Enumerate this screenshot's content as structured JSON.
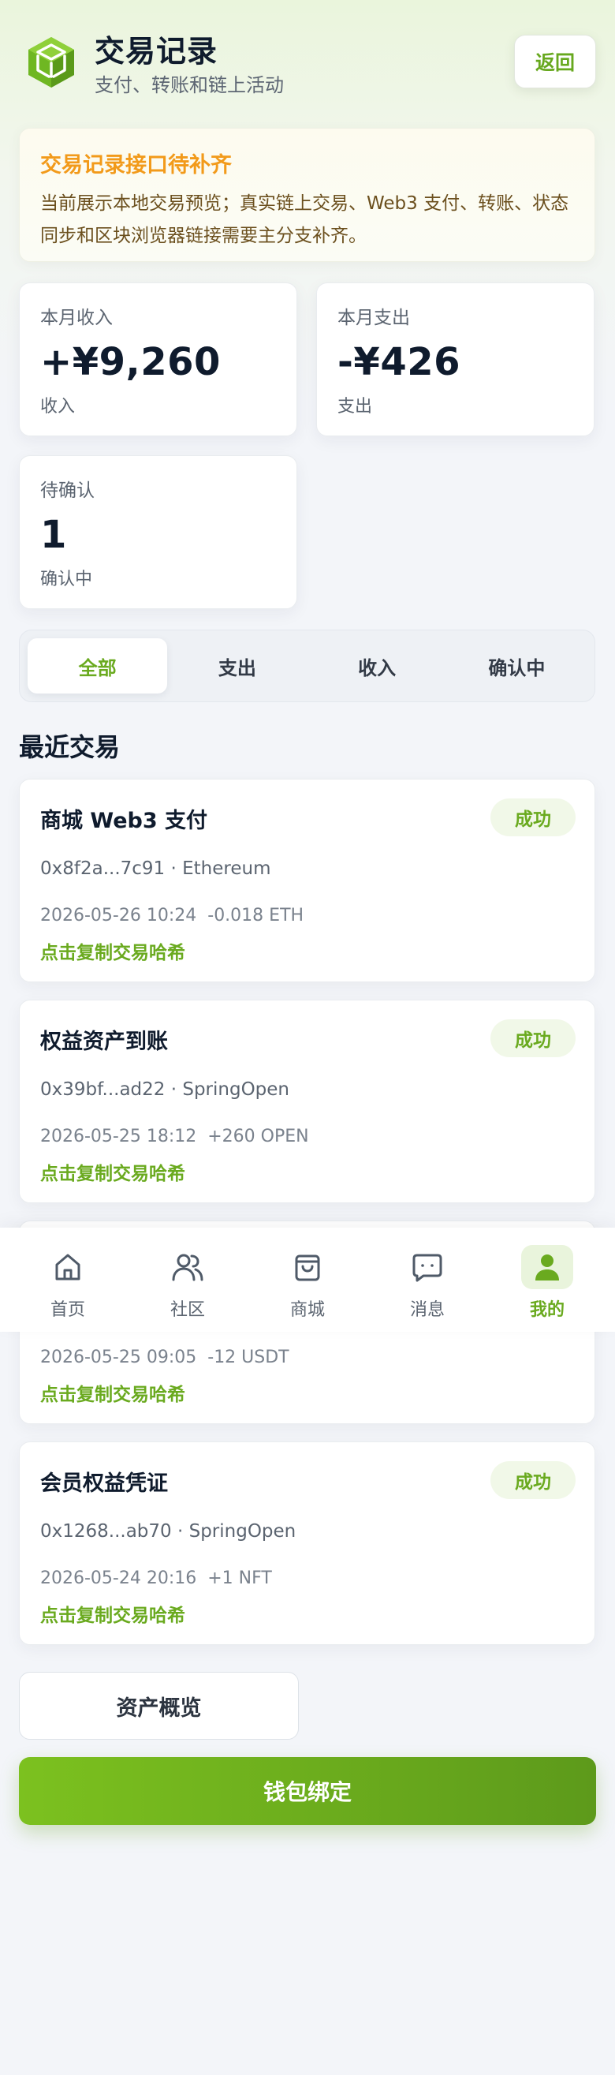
{
  "header": {
    "title": "交易记录",
    "subtitle": "支付、转账和链上活动",
    "back_label": "返回"
  },
  "notice": {
    "title": "交易记录接口待补齐",
    "text": "当前展示本地交易预览；真实链上交易、Web3 支付、转账、状态同步和区块浏览器链接需要主分支补齐。"
  },
  "stats": [
    {
      "label": "本月收入",
      "value": "+¥9,260",
      "sub": "收入"
    },
    {
      "label": "本月支出",
      "value": "-¥426",
      "sub": "支出"
    },
    {
      "label": "待确认",
      "value": "1",
      "sub": "确认中"
    }
  ],
  "tabs": [
    {
      "label": "全部",
      "active": true
    },
    {
      "label": "支出",
      "active": false
    },
    {
      "label": "收入",
      "active": false
    },
    {
      "label": "确认中",
      "active": false
    }
  ],
  "section_title": "最近交易",
  "transactions": [
    {
      "title": "商城 Web3 支付",
      "status": "成功",
      "address": "0x8f2a...7c91 · Ethereum",
      "time": "2026-05-26 10:24",
      "amount": "-0.018 ETH",
      "copy_label": "点击复制交易哈希"
    },
    {
      "title": "权益资产到账",
      "status": "成功",
      "address": "0x39bf...ad22 · SpringOpen",
      "time": "2026-05-25 18:12",
      "amount": "+260 OPEN",
      "copy_label": "点击复制交易哈希"
    },
    {
      "title": "",
      "status": "",
      "address": "",
      "time": "2026-05-25 09:05",
      "amount": "-12 USDT",
      "copy_label": "点击复制交易哈希"
    },
    {
      "title": "会员权益凭证",
      "status": "成功",
      "address": "0x1268...ab70 · SpringOpen",
      "time": "2026-05-24 20:16",
      "amount": "+1 NFT",
      "copy_label": "点击复制交易哈希"
    }
  ],
  "bottom_nav": [
    {
      "label": "首页",
      "icon": "home-icon",
      "active": false
    },
    {
      "label": "社区",
      "icon": "users-icon",
      "active": false
    },
    {
      "label": "商城",
      "icon": "shopping-bag-icon",
      "active": false
    },
    {
      "label": "消息",
      "icon": "message-icon",
      "active": false
    },
    {
      "label": "我的",
      "icon": "user-icon",
      "active": true
    }
  ],
  "buttons": {
    "overview_label": "资产概览",
    "wallet_label": "钱包绑定"
  },
  "colors": {
    "accent": "#6aaa1f",
    "warning": "#f29a1a",
    "badge_bg": "#f1f8e8"
  }
}
